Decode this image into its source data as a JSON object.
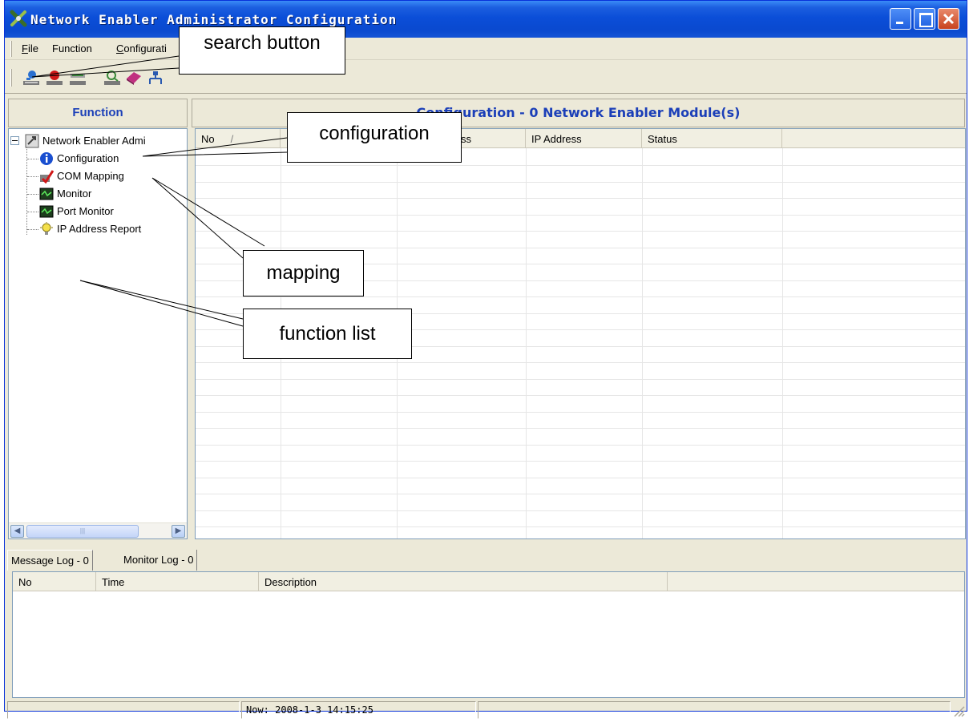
{
  "window": {
    "title": "Network Enabler Administrator Configuration",
    "accent": "#0b4ed8"
  },
  "menu": {
    "items": [
      {
        "label_u": "F",
        "label_rest": "ile"
      },
      {
        "label_u": "",
        "label_rest": "Function"
      },
      {
        "label_u": "C",
        "label_rest": "onfigurati"
      }
    ]
  },
  "toolbar": {
    "icons": [
      "search-network-icon",
      "stop-icon",
      "device-icon",
      "locate-icon",
      "book-icon",
      "network-icon"
    ]
  },
  "function_pane": {
    "header": "Function",
    "root_label": "Network Enabler Admi",
    "items": [
      {
        "label": "Configuration",
        "icon": "info-icon"
      },
      {
        "label": "COM Mapping",
        "icon": "com-mapping-icon"
      },
      {
        "label": "Monitor",
        "icon": "monitor-icon"
      },
      {
        "label": "Port Monitor",
        "icon": "port-monitor-icon"
      },
      {
        "label": "IP Address Report",
        "icon": "lightbulb-icon"
      }
    ]
  },
  "config_pane": {
    "header": "Configuration - 0 Network Enabler Module(s)",
    "columns": [
      "No",
      "M",
      "ss",
      "IP Address",
      "Status",
      ""
    ]
  },
  "log_tabs": [
    {
      "label": "Message Log - 0"
    },
    {
      "label": "Monitor Log - 0"
    }
  ],
  "log_columns": [
    "No",
    "Time",
    "Description",
    ""
  ],
  "status": {
    "now": "Now: 2008-1-3 14:15:25"
  },
  "callouts": {
    "search": "search button",
    "configuration": "configuration",
    "mapping": "mapping",
    "function_list": "function list"
  }
}
